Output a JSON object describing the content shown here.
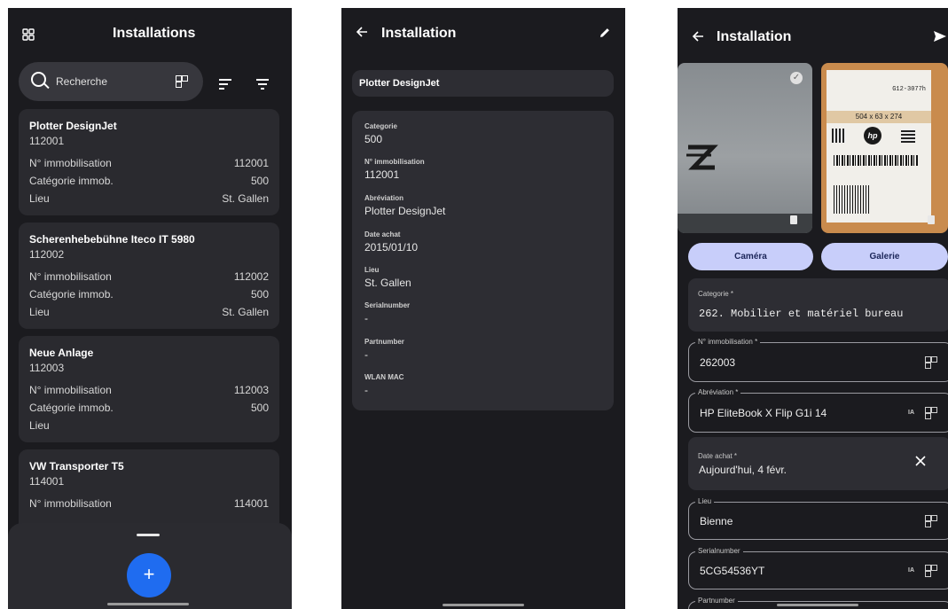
{
  "screen1": {
    "title": "Installations",
    "search_placeholder": "Recherche",
    "cards": [
      {
        "title": "Plotter DesignJet",
        "id": "112001",
        "rows": [
          [
            "N° immobilisation",
            "112001"
          ],
          [
            "Catégorie immob.",
            "500"
          ],
          [
            "Lieu",
            "St. Gallen"
          ]
        ]
      },
      {
        "title": "Scherenhebebühne Iteco IT 5980",
        "id": "112002",
        "rows": [
          [
            "N° immobilisation",
            "112002"
          ],
          [
            "Catégorie immob.",
            "500"
          ],
          [
            "Lieu",
            "St. Gallen"
          ]
        ]
      },
      {
        "title": "Neue Anlage",
        "id": "112003",
        "rows": [
          [
            "N° immobilisation",
            "112003"
          ],
          [
            "Catégorie immob.",
            "500"
          ],
          [
            "Lieu",
            ""
          ]
        ]
      },
      {
        "title": "VW Transporter T5",
        "id": "114001",
        "rows": [
          [
            "N° immobilisation",
            "114001"
          ]
        ]
      }
    ],
    "fab_label": "+"
  },
  "screen2": {
    "title": "Installation",
    "name_field": "Plotter DesignJet",
    "details": [
      {
        "label": "Categorie",
        "value": "500"
      },
      {
        "label": "N° immobilisation",
        "value": "112001"
      },
      {
        "label": "Abréviation",
        "value": "Plotter DesignJet"
      },
      {
        "label": "Date achat",
        "value": "2015/01/10"
      },
      {
        "label": "Lieu",
        "value": "St. Gallen"
      },
      {
        "label": "Serialnumber",
        "value": "-"
      },
      {
        "label": "Partnumber",
        "value": "-"
      },
      {
        "label": "WLAN MAC",
        "value": "-"
      }
    ]
  },
  "screen3": {
    "title": "Installation",
    "camera_button": "Caméra",
    "gallery_button": "Galerie",
    "label_texts": {
      "size": "504 x 63 x 274",
      "code": "G12-3077h",
      "brand": "hp"
    },
    "fields": {
      "categorie": {
        "label": "Categorie *",
        "value": "262. Mobilier et matériel bureau"
      },
      "immobilisation": {
        "label": "N° immobilisation *",
        "value": "262003"
      },
      "abreviation": {
        "label": "Abréviation *",
        "value": "HP EliteBook X Flip G1i 14",
        "ia": "IA"
      },
      "date": {
        "label": "Date achat *",
        "value": "Aujourd'hui, 4 févr."
      },
      "lieu": {
        "label": "Lieu",
        "value": "Bienne"
      },
      "serial": {
        "label": "Serialnumber",
        "value": "5CG54536YT",
        "ia": "IA"
      },
      "partnumber": {
        "label": "Partnumber"
      }
    }
  },
  "colors": {
    "background": "#1b1b1f",
    "card": "#2a2a2f",
    "fab": "#1f6cf0",
    "button": "#c8cefa"
  }
}
